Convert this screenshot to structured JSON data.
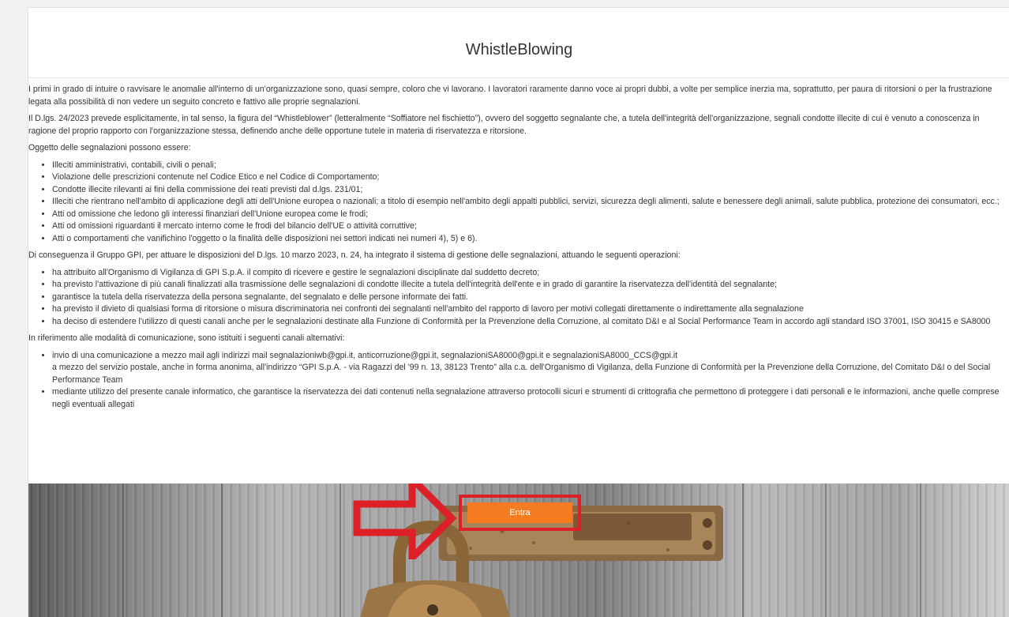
{
  "page": {
    "title": "WhistleBlowing"
  },
  "intro": {
    "p1": "I primi in grado di intuire o ravvisare le anomalie all'interno di un'organizzazione sono, quasi sempre, coloro che vi lavorano. I lavoratori raramente danno voce ai propri dubbi, a volte per semplice inerzia ma, soprattutto, per paura di ritorsioni o per la frustrazione legata alla possibilità di non vedere un seguito concreto e fattivo alle proprie segnalazioni.",
    "p2": "Il D.lgs. 24/2023 prevede esplicitamente, in tal senso, la figura del “Whistleblower” (letteralmente “Soffiatore nel fischietto”), ovvero del soggetto segnalante che, a tutela dell'integrità dell'organizzazione, segnali condotte illecite di cui è venuto a conoscenza in ragione del proprio rapporto con l'organizzazione stessa, definendo anche delle opportune tutele in materia di riservatezza e ritorsione.",
    "p3": "Oggetto delle segnalazioni possono essere:"
  },
  "objects": [
    "Illeciti amministrativi, contabili, civili o penali;",
    "Violazione delle prescrizioni contenute nel Codice Etico e nel Codice di Comportamento;",
    "Condotte illecite rilevanti ai fini della commissione dei reati previsti dal d.lgs. 231/01;",
    "Illeciti che rientrano nell'ambito di applicazione degli atti dell'Unione europea o nazionali; a titolo di esempio nell'ambito degli appalti pubblici, servizi, sicurezza degli alimenti, salute e benessere degli animali, salute pubblica, protezione dei consumatori, ecc.;",
    "Atti od omissione che ledono gli interessi finanziari dell'Unione europea come le frodi;",
    "Atti od omissioni riguardanti il mercato interno come le frodi del bilancio dell'UE o attività corruttive;",
    "Atti o comportamenti che vanifichino l'oggetto o la finalità delle disposizioni nei settori indicati nei numeri 4), 5) e 6)."
  ],
  "gpi": {
    "intro": "Di conseguenza il Gruppo GPI, per attuare le disposizioni del D.lgs. 10 marzo 2023, n. 24, ha integrato il sistema di gestione delle segnalazioni, attuando le seguenti operazioni:",
    "items": [
      "ha attribuito all'Organismo di Vigilanza di GPI S.p.A. il compito di ricevere e gestire le segnalazioni disciplinate dal suddetto decreto;",
      "ha previsto l'attivazione di più canali finalizzati alla trasmissione delle segnalazioni di condotte illecite a tutela dell'integrità dell'ente e in grado di garantire la riservatezza dell'identità del segnalante;",
      "garantisce la tutela della riservatezza della persona segnalante, del segnalato e delle persone informate dei fatti.",
      "ha previsto il divieto di qualsiasi forma di ritorsione o misura discriminatoria nei confronti dei segnalanti nell'ambito del rapporto di lavoro per motivi collegati direttamente o indirettamente alla segnalazione",
      "ha deciso di estendere l'utilizzo di questi canali anche per le segnalazioni destinate alla Funzione di Conformità per la Prevenzione della Corruzione, al comitato D&I e al Social Performance Team in accordo agli standard ISO 37001, ISO 30415 e SA8000"
    ]
  },
  "channels": {
    "intro": "In riferimento alle modalità di comunicazione, sono istituiti i seguenti canali alternativi:",
    "item1_line1": "invio di una comunicazione a mezzo mail agli indirizzi mail segnalazioniwb@gpi.it, anticorruzione@gpi.it, segnalazioniSA8000@gpi.it e segnalazioniSA8000_CCS@gpi.it",
    "item1_line2": "a mezzo del servizio postale, anche in forma anonima, all'indirizzo “GPI S.p.A. - via Ragazzi del '99 n. 13, 38123 Trento” alla c.a. dell'Organismo di Vigilanza, della Funzione di Conformità per la Prevenzione della Corruzione, del Comitato D&I o del Social Performance Team",
    "item2": "mediante utilizzo del presente canale informatico, che garantisce la riservatezza dei dati contenuti nella segnalazione attraverso protocolli sicuri e strumenti di crittografia che permettono di proteggere i dati personali e le informazioni, anche quelle comprese negli eventuali allegati"
  },
  "hero": {
    "enter_label": "Entra",
    "button_color": "#f47b20",
    "highlight_color": "#dd1f27",
    "arrow_icon": "arrow-right-icon",
    "image": "padlock-on-wooden-door"
  }
}
